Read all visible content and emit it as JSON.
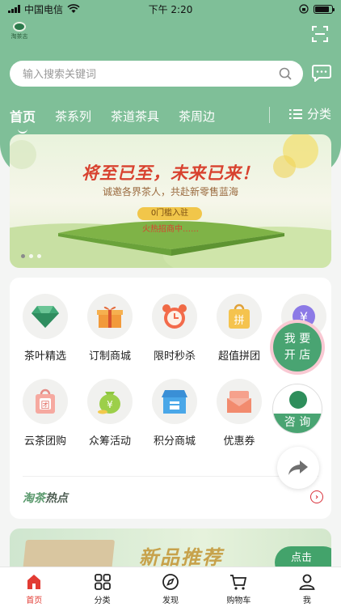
{
  "status_bar": {
    "carrier": "中国电信",
    "time": "下午 2:20"
  },
  "header": {
    "logo_text": "淘茶志"
  },
  "search": {
    "placeholder": "输入搜索关键词"
  },
  "tabs": [
    {
      "label": "首页",
      "active": true
    },
    {
      "label": "茶系列",
      "active": false
    },
    {
      "label": "茶道茶具",
      "active": false
    },
    {
      "label": "茶周边",
      "active": false
    }
  ],
  "category_label": "分类",
  "banner": {
    "title": "将至已至，未来已来！",
    "subtitle": "诚邀各界茶人，共赴新零售蓝海",
    "badge": "0门槛入驻",
    "hot_text": "火热招商中……",
    "page_count": 3,
    "current_page": 1
  },
  "grid_items": [
    {
      "label": "茶叶精选",
      "icon": "diamond-icon"
    },
    {
      "label": "订制商城",
      "icon": "gift-icon"
    },
    {
      "label": "限时秒杀",
      "icon": "alarm-clock-icon"
    },
    {
      "label": "超值拼团",
      "icon": "shopping-bag-icon"
    },
    {
      "label": "",
      "icon": "yen-coin-icon"
    },
    {
      "label": "云茶团购",
      "icon": "group-bag-icon"
    },
    {
      "label": "众筹活动",
      "icon": "money-bag-icon"
    },
    {
      "label": "积分商城",
      "icon": "store-icon"
    },
    {
      "label": "优惠券",
      "icon": "coupon-icon"
    }
  ],
  "float_buttons": {
    "open_store_line1": "我 要",
    "open_store_line2": "开 店",
    "consult": "咨 询"
  },
  "hot_section": {
    "title_green": "淘茶",
    "title_dark": "热点"
  },
  "promo": {
    "title": "新品推荐",
    "button": "点击"
  },
  "bottom_nav": [
    {
      "label": "首页",
      "icon": "home-icon",
      "active": true
    },
    {
      "label": "分类",
      "icon": "grid-icon",
      "active": false
    },
    {
      "label": "发现",
      "icon": "compass-icon",
      "active": false
    },
    {
      "label": "购物车",
      "icon": "cart-icon",
      "active": false
    },
    {
      "label": "我",
      "icon": "user-icon",
      "active": false
    }
  ],
  "colors": {
    "primary_green": "#7fbf98",
    "accent_red": "#e23b33",
    "button_green": "#49a472"
  }
}
